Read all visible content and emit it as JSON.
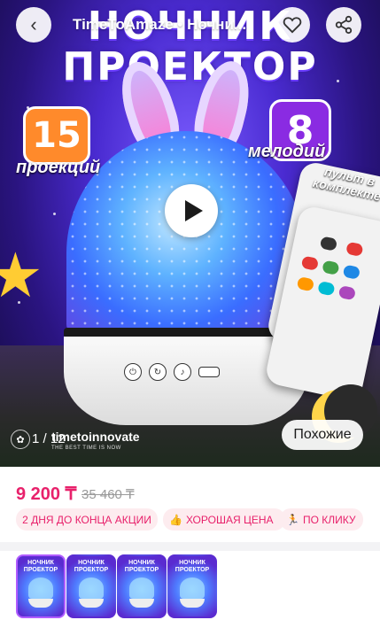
{
  "header": {
    "shop_title": "TimeToAmaze • Ночни...",
    "back_icon": "chevron-left-icon",
    "favorite_icon": "heart-icon",
    "share_icon": "share-icon"
  },
  "image": {
    "headline_line1": "НОЧНИК",
    "headline_line2": "ПРОЕКТОР",
    "badge_projections_number": "15",
    "badge_projections_label": "проекций",
    "badge_melodies_number": "8",
    "badge_melodies_label": "мелодий",
    "remote_caption": "пульт в комплекте",
    "counter": "1 / 12",
    "brand_name": "timetoinnovate",
    "brand_tagline": "THE BEST TIME IS NOW",
    "similar_button": "Похожие",
    "play_icon": "play-icon"
  },
  "pricing": {
    "current_price": "9 200 ₸",
    "old_price": "35 460 ₸"
  },
  "chips": [
    {
      "label": "2 ДНЯ ДО КОНЦА АКЦИИ",
      "icon": ""
    },
    {
      "label": "ХОРОШАЯ ЦЕНА",
      "icon": "thumbs-up-icon"
    },
    {
      "label": "ПО КЛИКУ",
      "icon": "running-person-icon"
    }
  ],
  "thumbnails": [
    {
      "title": "НОЧНИК ПРОЕКТОР",
      "selected": true
    },
    {
      "title": "НОЧНИК ПРОЕКТОР",
      "selected": false
    },
    {
      "title": "НОЧНИК ПРОЕКТОР",
      "selected": false
    },
    {
      "title": "НОЧНИК ПРОЕКТОР",
      "selected": false
    }
  ],
  "colors": {
    "accent_pink": "#e8216b",
    "chip_background": "#fdecef",
    "thumb_selected_border": "#b05cff"
  }
}
